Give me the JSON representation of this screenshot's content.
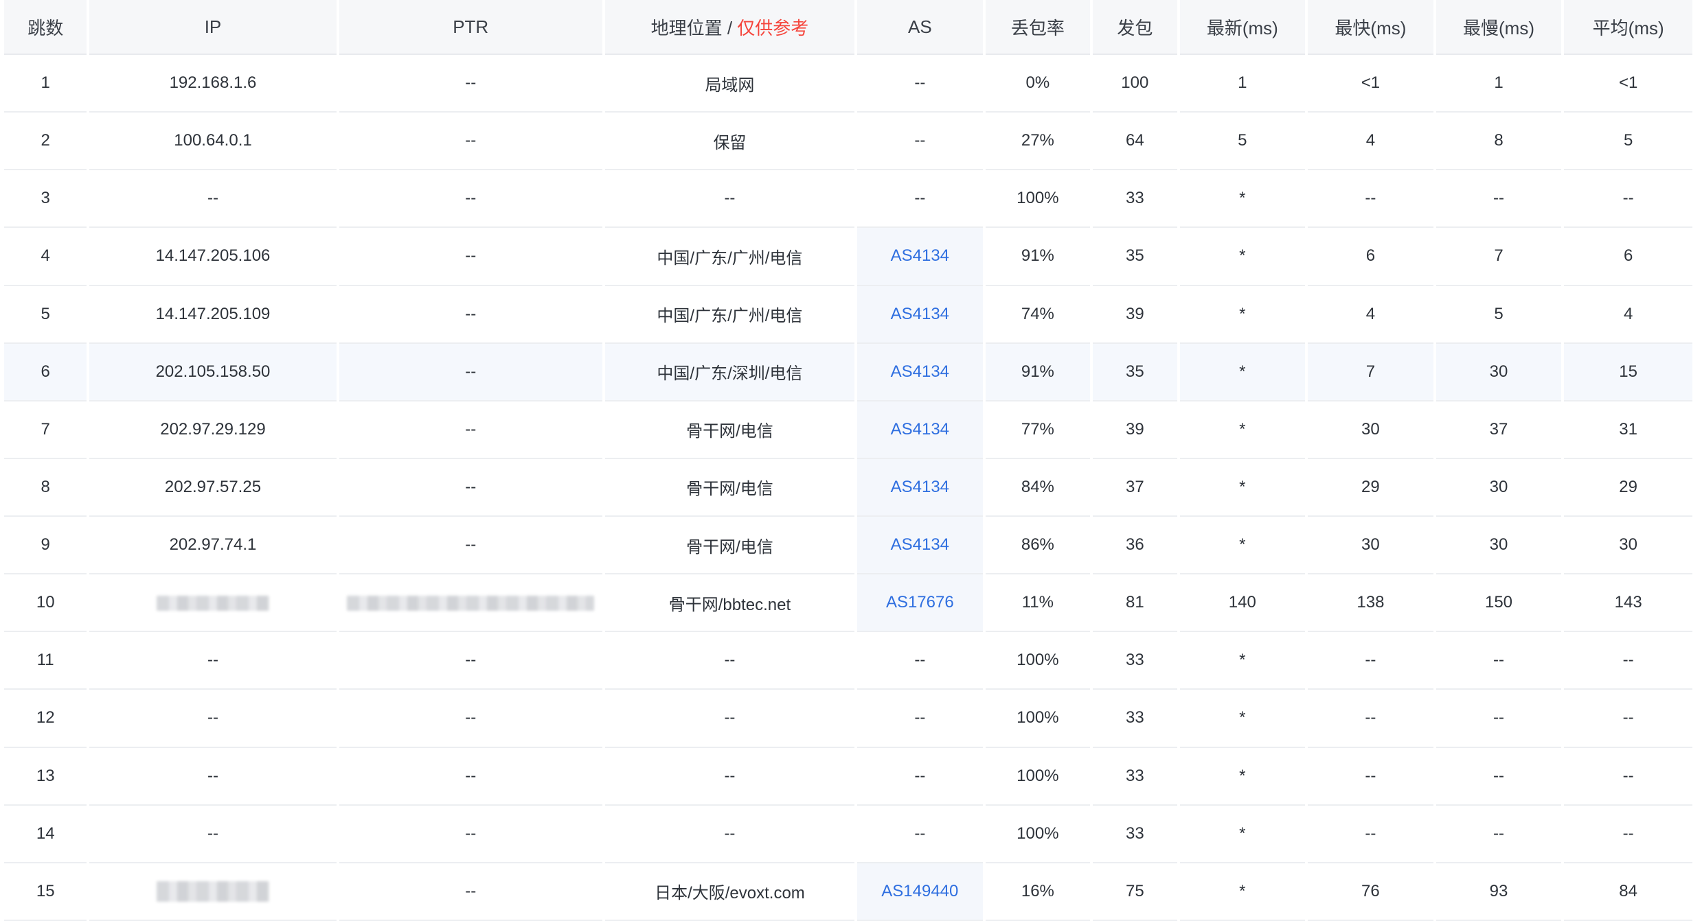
{
  "table": {
    "headers": {
      "hop": "跳数",
      "ip": "IP",
      "ptr": "PTR",
      "geo": "地理位置",
      "geo_sep": " / ",
      "geo_note": "仅供参考",
      "as": "AS",
      "loss": "丢包率",
      "sent": "发包",
      "last": "最新(ms)",
      "best": "最快(ms)",
      "worst": "最慢(ms)",
      "avg": "平均(ms)"
    },
    "rows": [
      {
        "hop": "1",
        "ip": "192.168.1.6",
        "ptr": "--",
        "geo": "局域网",
        "as": "--",
        "loss": "0%",
        "sent": "100",
        "last": "1",
        "best": "<1",
        "worst": "1",
        "avg": "<1"
      },
      {
        "hop": "2",
        "ip": "100.64.0.1",
        "ptr": "--",
        "geo": "保留",
        "as": "--",
        "loss": "27%",
        "sent": "64",
        "last": "5",
        "best": "4",
        "worst": "8",
        "avg": "5"
      },
      {
        "hop": "3",
        "ip": "--",
        "ptr": "--",
        "geo": "--",
        "as": "--",
        "loss": "100%",
        "sent": "33",
        "last": "*",
        "best": "--",
        "worst": "--",
        "avg": "--"
      },
      {
        "hop": "4",
        "ip": "14.147.205.106",
        "ptr": "--",
        "geo": "中国/广东/广州/电信",
        "as": "AS4134",
        "loss": "91%",
        "sent": "35",
        "last": "*",
        "best": "6",
        "worst": "7",
        "avg": "6"
      },
      {
        "hop": "5",
        "ip": "14.147.205.109",
        "ptr": "--",
        "geo": "中国/广东/广州/电信",
        "as": "AS4134",
        "loss": "74%",
        "sent": "39",
        "last": "*",
        "best": "4",
        "worst": "5",
        "avg": "4"
      },
      {
        "hop": "6",
        "ip": "202.105.158.50",
        "ptr": "--",
        "geo": "中国/广东/深圳/电信",
        "as": "AS4134",
        "loss": "91%",
        "sent": "35",
        "last": "*",
        "best": "7",
        "worst": "30",
        "avg": "15"
      },
      {
        "hop": "7",
        "ip": "202.97.29.129",
        "ptr": "--",
        "geo": "骨干网/电信",
        "as": "AS4134",
        "loss": "77%",
        "sent": "39",
        "last": "*",
        "best": "30",
        "worst": "37",
        "avg": "31"
      },
      {
        "hop": "8",
        "ip": "202.97.57.25",
        "ptr": "--",
        "geo": "骨干网/电信",
        "as": "AS4134",
        "loss": "84%",
        "sent": "37",
        "last": "*",
        "best": "29",
        "worst": "30",
        "avg": "29"
      },
      {
        "hop": "9",
        "ip": "202.97.74.1",
        "ptr": "--",
        "geo": "骨干网/电信",
        "as": "AS4134",
        "loss": "86%",
        "sent": "36",
        "last": "*",
        "best": "30",
        "worst": "30",
        "avg": "30"
      },
      {
        "hop": "10",
        "ip": "",
        "ptr": "",
        "geo": "骨干网/bbtec.net",
        "as": "AS17676",
        "loss": "11%",
        "sent": "81",
        "last": "140",
        "best": "138",
        "worst": "150",
        "avg": "143"
      },
      {
        "hop": "11",
        "ip": "--",
        "ptr": "--",
        "geo": "--",
        "as": "--",
        "loss": "100%",
        "sent": "33",
        "last": "*",
        "best": "--",
        "worst": "--",
        "avg": "--"
      },
      {
        "hop": "12",
        "ip": "--",
        "ptr": "--",
        "geo": "--",
        "as": "--",
        "loss": "100%",
        "sent": "33",
        "last": "*",
        "best": "--",
        "worst": "--",
        "avg": "--"
      },
      {
        "hop": "13",
        "ip": "--",
        "ptr": "--",
        "geo": "--",
        "as": "--",
        "loss": "100%",
        "sent": "33",
        "last": "*",
        "best": "--",
        "worst": "--",
        "avg": "--"
      },
      {
        "hop": "14",
        "ip": "--",
        "ptr": "--",
        "geo": "--",
        "as": "--",
        "loss": "100%",
        "sent": "33",
        "last": "*",
        "best": "--",
        "worst": "--",
        "avg": "--"
      },
      {
        "hop": "15",
        "ip": "",
        "ptr": "--",
        "geo": "日本/大阪/evoxt.com",
        "as": "AS149440",
        "loss": "16%",
        "sent": "75",
        "last": "*",
        "best": "76",
        "worst": "93",
        "avg": "84"
      }
    ]
  },
  "colors": {
    "header_bg": "#f6f7f9",
    "link": "#2f6fe0",
    "geo_note": "#f5443b",
    "highlight_row": "#f5f8fd"
  }
}
